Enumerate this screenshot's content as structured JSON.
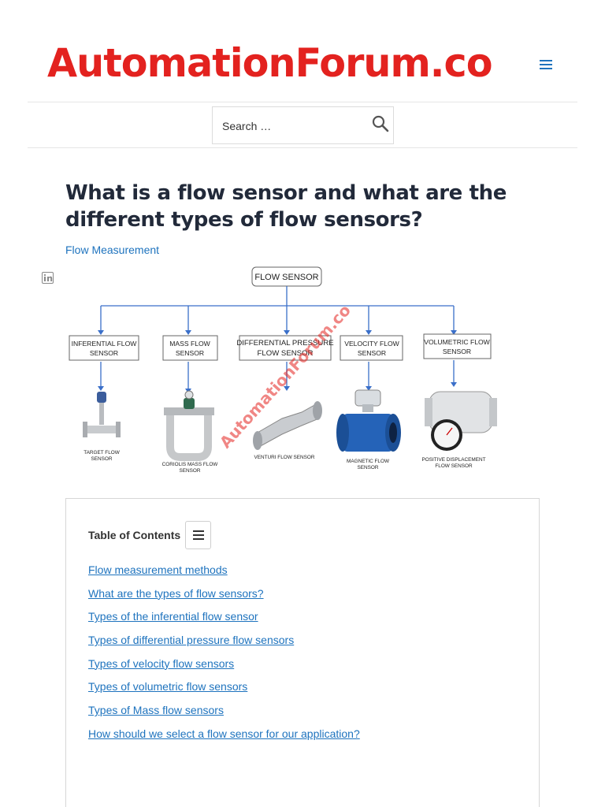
{
  "site": {
    "logo_text": "AutomationForum.co",
    "menu_icon": "hamburger-menu-icon",
    "brand_color": "#e3221f",
    "link_color": "#1e73be"
  },
  "search": {
    "placeholder": "Search …",
    "icon": "search-icon"
  },
  "article": {
    "title": "What is a flow sensor and what are the different types of flow sensors?",
    "category": "Flow Measurement",
    "share_icon": "linkedin-icon"
  },
  "figure": {
    "root_label": "FLOW SENSOR",
    "watermark": "AutomationForum.co",
    "branches": [
      {
        "header_lines": [
          "INFERENTIAL FLOW",
          "SENSOR"
        ],
        "device_lines": [
          "TARGET FLOW",
          "SENSOR"
        ]
      },
      {
        "header_lines": [
          "MASS FLOW",
          "SENSOR"
        ],
        "device_lines": [
          "CORIOLIS MASS FLOW",
          "SENSOR"
        ]
      },
      {
        "header_lines": [
          "DIFFERENTIAL PRESSURE",
          "FLOW SENSOR"
        ],
        "device_lines": [
          "VENTURI FLOW SENSOR"
        ]
      },
      {
        "header_lines": [
          "VELOCITY FLOW",
          "SENSOR"
        ],
        "device_lines": [
          "MAGNETIC FLOW",
          "SENSOR"
        ]
      },
      {
        "header_lines": [
          "VOLUMETRIC FLOW",
          "SENSOR"
        ],
        "device_lines": [
          "POSITIVE DISPLACEMENT",
          "FLOW SENSOR"
        ]
      }
    ]
  },
  "toc": {
    "title": "Table of Contents",
    "toggle_icon": "list-toggle-icon",
    "items": [
      "Flow measurement methods",
      "What are the types of flow sensors?",
      "Types of the inferential flow sensor",
      "Types of differential pressure flow sensors",
      "Types of velocity flow sensors",
      "Types of volumetric flow sensors",
      "Types of Mass flow sensors",
      "How should we select a flow sensor for our application?"
    ]
  }
}
